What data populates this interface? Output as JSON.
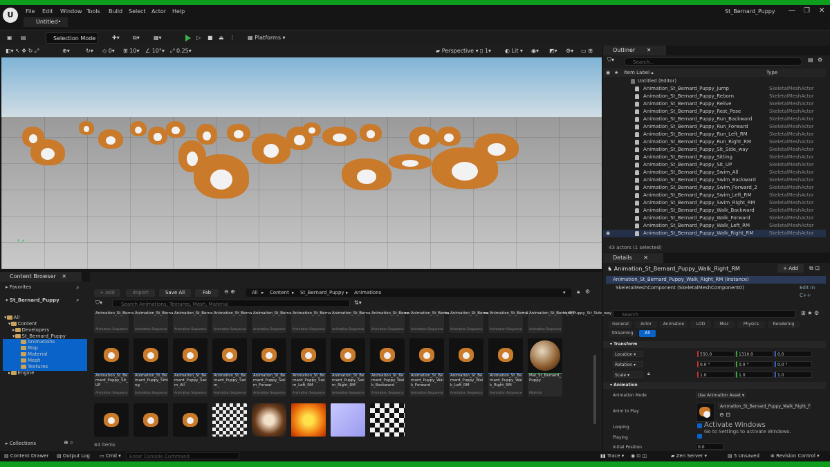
{
  "window": {
    "title": "St_Bernard_Puppy",
    "tab": "Untitled•",
    "controls": [
      "—",
      "❐",
      "✕"
    ]
  },
  "menu": [
    "File",
    "Edit",
    "Window",
    "Tools",
    "Build",
    "Select",
    "Actor",
    "Help"
  ],
  "toolbar": {
    "selection_mode": "Selection Mode",
    "platforms": "Platforms"
  },
  "viewport_tools": {
    "snap_angle": "0",
    "grid": "10",
    "rot": "10°",
    "scale": "0.25",
    "perspective": "Perspective",
    "view_count": "1",
    "lit": "Lit"
  },
  "outliner": {
    "tab": "Outliner",
    "search_placeholder": "Search...",
    "col_label": "Item Label ▴",
    "col_type": "Type",
    "root": "Untitled (Editor)",
    "items": [
      {
        "label": "Animation_St_Bernard_Puppy_Jump",
        "type": "SkeletalMeshActor"
      },
      {
        "label": "Animation_St_Bernard_Puppy_Reborn",
        "type": "SkeletalMeshActor"
      },
      {
        "label": "Animation_St_Bernard_Puppy_Relive",
        "type": "SkeletalMeshActor"
      },
      {
        "label": "Animation_St_Bernard_Puppy_Rest_Pose",
        "type": "SkeletalMeshActor"
      },
      {
        "label": "Animation_St_Bernard_Puppy_Run_Backward",
        "type": "SkeletalMeshActor"
      },
      {
        "label": "Animation_St_Bernard_Puppy_Run_Forward",
        "type": "SkeletalMeshActor"
      },
      {
        "label": "Animation_St_Bernard_Puppy_Run_Left_RM",
        "type": "SkeletalMeshActor"
      },
      {
        "label": "Animation_St_Bernard_Puppy_Run_Right_RM",
        "type": "SkeletalMeshActor"
      },
      {
        "label": "Animation_St_Bernard_Puppy_Sit_Side_way",
        "type": "SkeletalMeshActor"
      },
      {
        "label": "Animation_St_Bernard_Puppy_Sitting",
        "type": "SkeletalMeshActor"
      },
      {
        "label": "Animation_St_Bernard_Puppy_Sit_UP",
        "type": "SkeletalMeshActor"
      },
      {
        "label": "Animation_St_Bernard_Puppy_Swim_All",
        "type": "SkeletalMeshActor"
      },
      {
        "label": "Animation_St_Bernard_Puppy_Swim_Backward",
        "type": "SkeletalMeshActor"
      },
      {
        "label": "Animation_St_Bernard_Puppy_Swim_Forward_2",
        "type": "SkeletalMeshActor"
      },
      {
        "label": "Animation_St_Bernard_Puppy_Swim_Left_RM",
        "type": "SkeletalMeshActor"
      },
      {
        "label": "Animation_St_Bernard_Puppy_Swim_Right_RM",
        "type": "SkeletalMeshActor"
      },
      {
        "label": "Animation_St_Bernard_Puppy_Walk_Backward",
        "type": "SkeletalMeshActor"
      },
      {
        "label": "Animation_St_Bernard_Puppy_Walk_Forward",
        "type": "SkeletalMeshActor"
      },
      {
        "label": "Animation_St_Bernard_Puppy_Walk_Left_RM",
        "type": "SkeletalMeshActor"
      },
      {
        "label": "Animation_St_Bernard_Puppy_Walk_Right_RM",
        "type": "SkeletalMeshActor"
      }
    ],
    "footer": "43 actors (1 selected)"
  },
  "details": {
    "tab": "Details",
    "actor_name": "Animation_St_Bernard_Puppy_Walk_Right_RM",
    "add_label": "+ Add",
    "instance": "Animation_St_Bernard_Puppy_Walk_Right_RM (Instance)",
    "component": "SkeletalMeshComponent (SkeletalMeshComponent0)",
    "edit_cpp": "Edit in C++",
    "search_placeholder": "Search",
    "tabs": [
      "General",
      "Actor",
      "Animation",
      "LOD",
      "Misc",
      "Physics",
      "Rendering",
      "Streaming",
      "All"
    ],
    "transform_header": "Transform",
    "location_label": "Location",
    "location": [
      "550.0",
      "1310.0",
      "0.0"
    ],
    "rotation_label": "Rotation",
    "rotation": [
      "0.0 °",
      "0.0 °",
      "0.0 °"
    ],
    "scale_label": "Scale",
    "scale": [
      "1.0",
      "1.0",
      "1.0"
    ],
    "animation_header": "Animation",
    "anim_mode_label": "Animation Mode",
    "anim_mode": "Use Animation Asset",
    "anim_to_play_label": "Anim to Play",
    "anim_to_play": "Animation_St_Bernard_Puppy_Walk_Right_F",
    "looping_label": "Looping",
    "playing_label": "Playing",
    "initial_pos_label": "Initial Position",
    "initial_pos": "0.0"
  },
  "content_browser": {
    "tab": "Content Browser",
    "add": "+ Add",
    "import": "Import",
    "save_all": "Save All",
    "fab": "Fab",
    "breadcrumb": [
      "All",
      "Content",
      "St_Bernard_Puppy",
      "Animations"
    ],
    "search_placeholder": "Search Animations, Textures, Mesh, Material",
    "favorites": "Favorites",
    "project": "St_Bernard_Puppy",
    "tree": [
      "All",
      "Content",
      "Developers",
      "St_Bernard_Puppy",
      "Animations",
      "Map",
      "Material",
      "Mesh",
      "Textures",
      "Engine"
    ],
    "collections": "Collections",
    "count": "44 items",
    "top_row": [
      {
        "name": "Animation_St_Bernard_Puppy_IdleA",
        "type": "Animation Sequence"
      },
      {
        "name": "Animation_St_Bernard_Puppy_IdleB",
        "type": "Animation Sequence"
      },
      {
        "name": "Animation_St_Bernard_Puppy_IdleC",
        "type": "Animation Sequence"
      },
      {
        "name": "Animation_St_Bernard_Puppy_Jump",
        "type": "Animation Sequence"
      },
      {
        "name": "Animation_St_Bernard_Puppy_Reborn",
        "type": "Animation Sequence"
      },
      {
        "name": "Animation_St_Bernard_Puppy_Relive",
        "type": "Animation Sequence"
      },
      {
        "name": "Animation_St_Bernard_Puppy_Rest_Pose",
        "type": "Animation Sequence"
      },
      {
        "name": "Animation_St_Bernard_Puppy_Run_Backward",
        "type": "Animation Sequence"
      },
      {
        "name": "Animation_St_Bernard_Puppy_Run_Forward",
        "type": "Animation Sequence"
      },
      {
        "name": "Animation_St_Bernard_Puppy_Run_Left_RM",
        "type": "Animation Sequence"
      },
      {
        "name": "Animation_St_Bernard_Puppy_Run_Right_RM",
        "type": "Animation Sequence"
      },
      {
        "name": "Animation_St_Bernard_Puppy_Sit_Side_way",
        "type": "Animation Sequence"
      }
    ],
    "mid_row": [
      {
        "name": "Animation_St_Bernard_Puppy_Sit_UP",
        "type": "Animation Sequence"
      },
      {
        "name": "Animation_St_Bernard_Puppy_Sitting",
        "type": "Animation Sequence"
      },
      {
        "name": "Animation_St_Bernard_Puppy_Swim_All",
        "type": "Animation Sequence"
      },
      {
        "name": "Animation_St_Bernard_Puppy_Swim_",
        "type": "Animation Sequence"
      },
      {
        "name": "Animation_St_Bernard_Puppy_Swim_Forwar",
        "type": "Animation Sequence"
      },
      {
        "name": "Animation_St_Bernard_Puppy_Swim_Left_RM",
        "type": "Animation Sequence"
      },
      {
        "name": "Animation_St_Bernard_Puppy_Swim_Right_RM",
        "type": "Animation Sequence"
      },
      {
        "name": "Animation_St_Bernard_Puppy_Walk_Backward",
        "type": "Animation Sequence"
      },
      {
        "name": "Animation_St_Bernard_Puppy_Walk_Forward",
        "type": "Animation Sequence"
      },
      {
        "name": "Animation_St_Bernard_Puppy_Walk_Left_RM",
        "type": "Animation Sequence"
      },
      {
        "name": "Animation_St_Bernard_Puppy_Walk_Right_RM",
        "type": "Animation Sequence"
      },
      {
        "name": "Mat_St_Bernard_Puppy",
        "type": "Material"
      }
    ]
  },
  "status": {
    "drawer": "Content Drawer",
    "output": "Output Log",
    "cmd": "Cmd",
    "console_placeholder": "Enter Console Command",
    "trace": "Trace",
    "zen": "Zen Server",
    "unsaved": "5 Unsaved",
    "revision": "Revision Control"
  },
  "watermark": {
    "line1": "Activate Windows",
    "line2": "Go to Settings to activate Windows."
  }
}
